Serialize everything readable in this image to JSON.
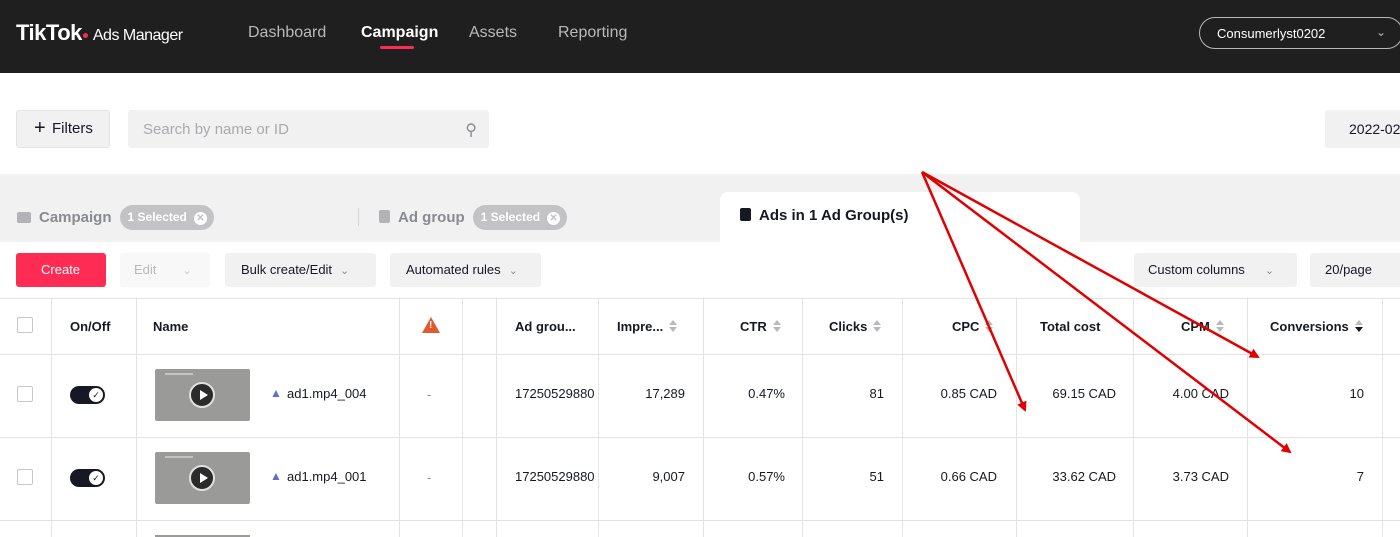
{
  "header": {
    "brand": "TikTok",
    "brand_sub": "Ads Manager",
    "nav": [
      "Dashboard",
      "Campaign",
      "Assets",
      "Reporting"
    ],
    "active_nav": "Campaign",
    "account": "Consumerlyst0202"
  },
  "filter_bar": {
    "filters_label": "Filters",
    "search_placeholder": "Search by name or ID",
    "date_partial": "2022-02"
  },
  "level_tabs": {
    "campaign_label": "Campaign",
    "campaign_badge": "1 Selected",
    "adgroup_label": "Ad group",
    "adgroup_badge": "1 Selected",
    "ads_label": "Ads in 1 Ad Group(s)"
  },
  "toolbar": {
    "create": "Create",
    "edit": "Edit",
    "bulk": "Bulk create/Edit",
    "rules": "Automated rules",
    "custom_columns": "Custom columns",
    "page_size": "20/page"
  },
  "table": {
    "headers": {
      "onoff": "On/Off",
      "name": "Name",
      "adgroup": "Ad grou...",
      "impressions": "Impre...",
      "ctr": "CTR",
      "clicks": "Clicks",
      "cpc": "CPC",
      "total_cost": "Total cost",
      "cpm": "CPM",
      "conversions": "Conversions"
    },
    "rows": [
      {
        "name": "ad1.mp4_004",
        "status": "-",
        "adgroup": "17250529880",
        "impressions": "17,289",
        "ctr": "0.47%",
        "clicks": "81",
        "cpc": "0.85 CAD",
        "total_cost": "69.15 CAD",
        "cpm": "4.00 CAD",
        "conversions": "10"
      },
      {
        "name": "ad1.mp4_001",
        "status": "-",
        "adgroup": "17250529880",
        "impressions": "9,007",
        "ctr": "0.57%",
        "clicks": "51",
        "cpc": "0.66 CAD",
        "total_cost": "33.62 CAD",
        "cpm": "3.73 CAD",
        "conversions": "7"
      }
    ]
  },
  "colors": {
    "accent": "#fe2c55",
    "header_bg": "#1f1f1f",
    "annotation_arrow": "#e00000"
  }
}
